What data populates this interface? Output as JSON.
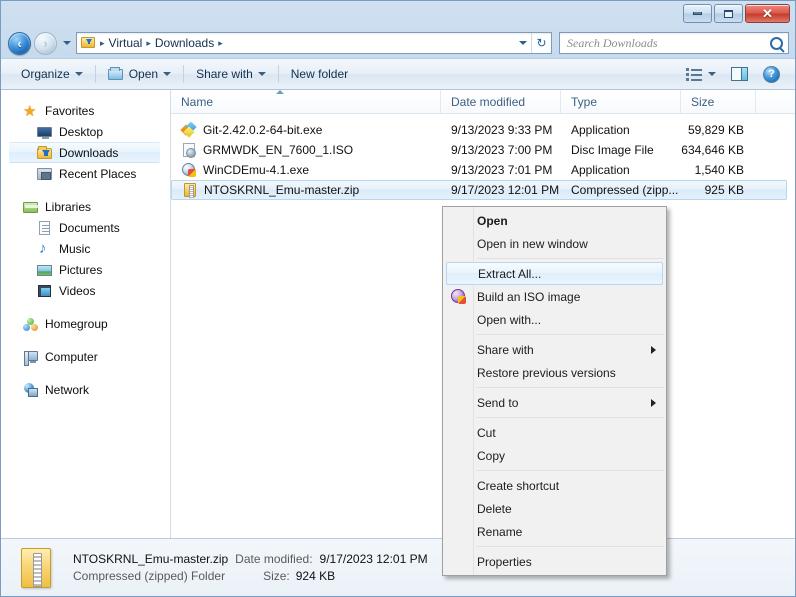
{
  "window": {
    "minimize_label": "Minimize",
    "maximize_label": "Maximize",
    "close_label": "✕"
  },
  "address": {
    "folder_icon": "downloads-folder-icon",
    "separator": "▸",
    "crumbs": [
      "Virtual",
      "Downloads"
    ],
    "trailing_separator": "▸",
    "dropdown_icon": "chevron-down-icon",
    "refresh_icon": "refresh-icon",
    "refresh_glyph": "↻"
  },
  "search": {
    "placeholder": "Search Downloads",
    "icon": "search-icon"
  },
  "toolbar": {
    "organize": "Organize",
    "open": "Open",
    "share_with": "Share with",
    "new_folder": "New folder",
    "view_icon": "list-view-icon",
    "preview_icon": "preview-pane-icon",
    "help_icon": "help-icon",
    "help_glyph": "?"
  },
  "navpane": {
    "groups": [
      {
        "header": {
          "label": "Favorites",
          "icon": "star-icon"
        },
        "items": [
          {
            "label": "Desktop",
            "icon": "desktop-icon",
            "selected": false
          },
          {
            "label": "Downloads",
            "icon": "downloads-folder-icon",
            "selected": true
          },
          {
            "label": "Recent Places",
            "icon": "recent-places-icon",
            "selected": false
          }
        ]
      },
      {
        "header": {
          "label": "Libraries",
          "icon": "libraries-icon"
        },
        "items": [
          {
            "label": "Documents",
            "icon": "documents-icon",
            "selected": false
          },
          {
            "label": "Music",
            "icon": "music-icon",
            "selected": false
          },
          {
            "label": "Pictures",
            "icon": "pictures-icon",
            "selected": false
          },
          {
            "label": "Videos",
            "icon": "videos-icon",
            "selected": false
          }
        ]
      },
      {
        "header": {
          "label": "Homegroup",
          "icon": "homegroup-icon"
        },
        "items": []
      },
      {
        "header": {
          "label": "Computer",
          "icon": "computer-icon"
        },
        "items": []
      },
      {
        "header": {
          "label": "Network",
          "icon": "network-icon"
        },
        "items": []
      }
    ]
  },
  "filelist": {
    "columns": [
      "Name",
      "Date modified",
      "Type",
      "Size"
    ],
    "sorted_by": "Name",
    "rows": [
      {
        "name": "Git-2.42.0.2-64-bit.exe",
        "date_modified": "9/13/2023 9:33 PM",
        "type": "Application",
        "size": "59,829 KB",
        "icon": "git-installer-icon",
        "selected": false
      },
      {
        "name": "GRMWDK_EN_7600_1.ISO",
        "date_modified": "9/13/2023 7:00 PM",
        "type": "Disc Image File",
        "size": "634,646 KB",
        "icon": "disc-image-icon",
        "selected": false
      },
      {
        "name": "WinCDEmu-4.1.exe",
        "date_modified": "9/13/2023 7:01 PM",
        "type": "Application",
        "size": "1,540 KB",
        "icon": "wincdemu-icon",
        "selected": false
      },
      {
        "name": "NTOSKRNL_Emu-master.zip",
        "date_modified": "9/17/2023 12:01 PM",
        "type": "Compressed (zipp...",
        "size": "925 KB",
        "icon": "zip-folder-icon",
        "selected": true
      }
    ]
  },
  "context_menu": {
    "items": [
      {
        "label": "Open",
        "bold": true,
        "icon": null,
        "submenu": false,
        "separator_after": false,
        "hover": false
      },
      {
        "label": "Open in new window",
        "bold": false,
        "icon": null,
        "submenu": false,
        "separator_after": true,
        "hover": false
      },
      {
        "label": "Extract All...",
        "bold": false,
        "icon": null,
        "submenu": false,
        "separator_after": false,
        "hover": true
      },
      {
        "label": "Build an ISO image",
        "bold": false,
        "icon": "wincdemu-icon",
        "submenu": false,
        "separator_after": false,
        "hover": false
      },
      {
        "label": "Open with...",
        "bold": false,
        "icon": null,
        "submenu": false,
        "separator_after": true,
        "hover": false
      },
      {
        "label": "Share with",
        "bold": false,
        "icon": null,
        "submenu": true,
        "separator_after": false,
        "hover": false
      },
      {
        "label": "Restore previous versions",
        "bold": false,
        "icon": null,
        "submenu": false,
        "separator_after": true,
        "hover": false
      },
      {
        "label": "Send to",
        "bold": false,
        "icon": null,
        "submenu": true,
        "separator_after": true,
        "hover": false
      },
      {
        "label": "Cut",
        "bold": false,
        "icon": null,
        "submenu": false,
        "separator_after": false,
        "hover": false
      },
      {
        "label": "Copy",
        "bold": false,
        "icon": null,
        "submenu": false,
        "separator_after": true,
        "hover": false
      },
      {
        "label": "Create shortcut",
        "bold": false,
        "icon": null,
        "submenu": false,
        "separator_after": false,
        "hover": false
      },
      {
        "label": "Delete",
        "bold": false,
        "icon": null,
        "submenu": false,
        "separator_after": false,
        "hover": false
      },
      {
        "label": "Rename",
        "bold": false,
        "icon": null,
        "submenu": false,
        "separator_after": true,
        "hover": false
      },
      {
        "label": "Properties",
        "bold": false,
        "icon": null,
        "submenu": false,
        "separator_after": false,
        "hover": false
      }
    ]
  },
  "details_pane": {
    "icon": "zip-folder-large-icon",
    "file_name": "NTOSKRNL_Emu-master.zip",
    "date_modified_label": "Date modified:",
    "date_modified_value": "9/17/2023 12:01 PM",
    "file_type": "Compressed (zipped) Folder",
    "size_label": "Size:",
    "size_value": "924 KB"
  },
  "colors": {
    "selection_blue": "#d9eafa",
    "selection_border": "#b8d6ee",
    "close_red": "#c63c2d",
    "accent": "#1c5fa8"
  }
}
